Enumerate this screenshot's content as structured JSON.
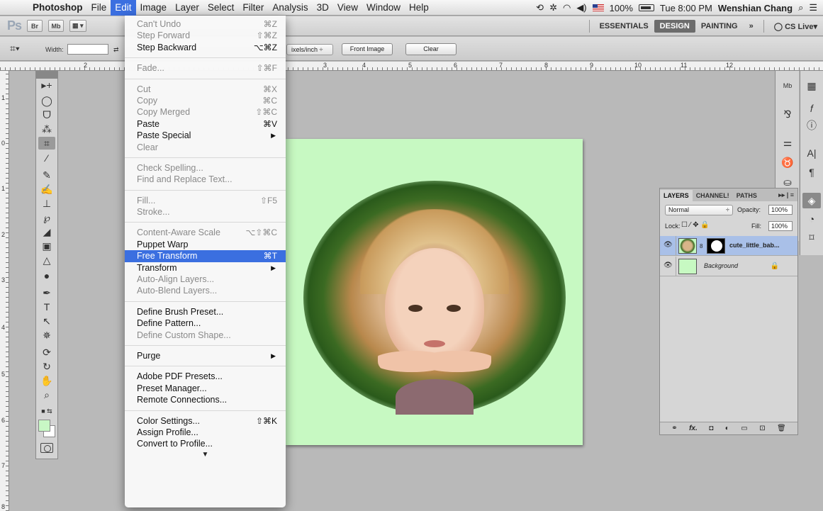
{
  "menubar": {
    "app_name": "Photoshop",
    "items": [
      "File",
      "Edit",
      "Image",
      "Layer",
      "Select",
      "Filter",
      "Analysis",
      "3D",
      "View",
      "Window",
      "Help"
    ],
    "active_item": "Edit",
    "battery": "100%",
    "clock": "Tue 8:00 PM",
    "user": "Wenshian Chang"
  },
  "appbar": {
    "logo": "Ps",
    "bridge_btn": "Br",
    "minibridge_btn": "Mb",
    "workspaces": [
      "ESSENTIALS",
      "DESIGN",
      "PAINTING"
    ],
    "active_workspace": "DESIGN",
    "more": "»",
    "cslive": "CS Live"
  },
  "optbar": {
    "width_label": "Width:",
    "resolution_units": "ixels/inch",
    "front_image": "Front Image",
    "clear": "Clear"
  },
  "ruler": {
    "top": [
      "2",
      "3",
      "4",
      "5",
      "6",
      "7",
      "8",
      "9",
      "10",
      "11",
      "12"
    ],
    "left": [
      "1",
      "0",
      "1",
      "2",
      "3",
      "4",
      "5",
      "6",
      "7",
      "8"
    ]
  },
  "edit_menu": {
    "items": [
      {
        "label": "Can't Undo",
        "shortcut": "⌘Z",
        "disabled": true
      },
      {
        "label": "Step Forward",
        "shortcut": "⇧⌘Z",
        "disabled": true
      },
      {
        "label": "Step Backward",
        "shortcut": "⌥⌘Z",
        "disabled": false
      },
      {
        "sep": true
      },
      {
        "label": "Fade...",
        "shortcut": "⇧⌘F",
        "disabled": true
      },
      {
        "sep": true
      },
      {
        "label": "Cut",
        "shortcut": "⌘X",
        "disabled": true
      },
      {
        "label": "Copy",
        "shortcut": "⌘C",
        "disabled": true
      },
      {
        "label": "Copy Merged",
        "shortcut": "⇧⌘C",
        "disabled": true
      },
      {
        "label": "Paste",
        "shortcut": "⌘V",
        "disabled": false
      },
      {
        "label": "Paste Special",
        "submenu": true,
        "disabled": false
      },
      {
        "label": "Clear",
        "disabled": true
      },
      {
        "sep": true
      },
      {
        "label": "Check Spelling...",
        "disabled": true
      },
      {
        "label": "Find and Replace Text...",
        "disabled": true
      },
      {
        "sep": true
      },
      {
        "label": "Fill...",
        "shortcut": "⇧F5",
        "disabled": true
      },
      {
        "label": "Stroke...",
        "disabled": true
      },
      {
        "sep": true
      },
      {
        "label": "Content-Aware Scale",
        "shortcut": "⌥⇧⌘C",
        "disabled": true
      },
      {
        "label": "Puppet Warp",
        "disabled": false
      },
      {
        "label": "Free Transform",
        "shortcut": "⌘T",
        "disabled": false,
        "highlighted": true
      },
      {
        "label": "Transform",
        "submenu": true,
        "disabled": false
      },
      {
        "label": "Auto-Align Layers...",
        "disabled": true
      },
      {
        "label": "Auto-Blend Layers...",
        "disabled": true
      },
      {
        "sep": true
      },
      {
        "label": "Define Brush Preset...",
        "disabled": false
      },
      {
        "label": "Define Pattern...",
        "disabled": false
      },
      {
        "label": "Define Custom Shape...",
        "disabled": true
      },
      {
        "sep": true
      },
      {
        "label": "Purge",
        "submenu": true,
        "disabled": false
      },
      {
        "sep": true
      },
      {
        "label": "Adobe PDF Presets...",
        "disabled": false
      },
      {
        "label": "Preset Manager...",
        "disabled": false
      },
      {
        "label": "Remote Connections...",
        "disabled": false
      },
      {
        "sep": true
      },
      {
        "label": "Color Settings...",
        "shortcut": "⇧⌘K",
        "disabled": false
      },
      {
        "label": "Assign Profile...",
        "disabled": false
      },
      {
        "label": "Convert to Profile...",
        "disabled": false
      }
    ],
    "more_arrow": "▼"
  },
  "layers_panel": {
    "tabs": [
      "LAYERS",
      "CHANNEL!",
      "PATHS"
    ],
    "blend_mode": "Normal",
    "opacity_label": "Opacity:",
    "opacity": "100%",
    "lock_label": "Lock:",
    "fill_label": "Fill:",
    "fill": "100%",
    "layers": [
      {
        "name": "cute_little_bab...",
        "selected": true
      },
      {
        "name": "Background",
        "selected": false,
        "locked": true
      }
    ],
    "footer_icons": [
      "link-icon",
      "fx-icon",
      "mask-icon",
      "adjustment-icon",
      "group-icon",
      "new-layer-icon",
      "trash-icon"
    ],
    "footer_glyphs": {
      "link": "⚭",
      "fx": "fx.",
      "mask": "◘",
      "adjustment": "◐",
      "group": "▭",
      "new": "⊡",
      "trash": "🗑"
    }
  },
  "colors": {
    "foreground": "#c8f7c5",
    "background": "#ffffff",
    "menu_highlight": "#3b6fe0",
    "canvas_bg": "#c7f9c2"
  }
}
